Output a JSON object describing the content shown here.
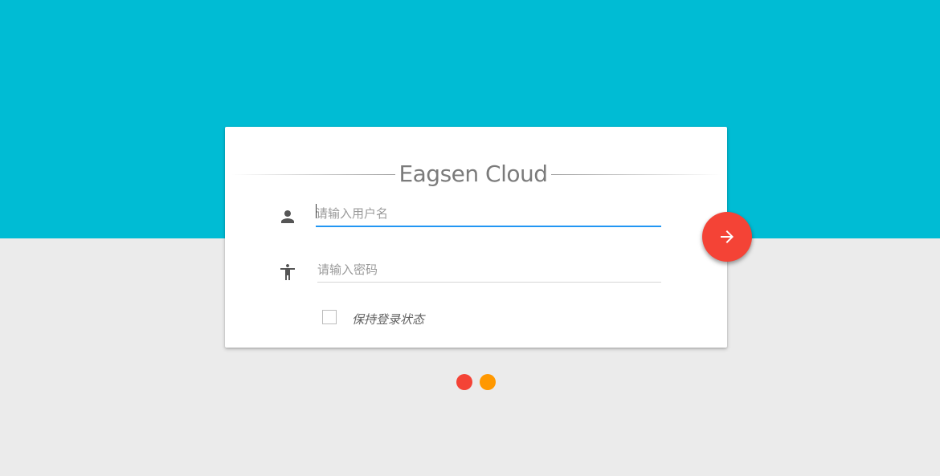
{
  "login": {
    "title": "Eagsen Cloud",
    "username": {
      "value": "",
      "placeholder": "请输入用户名",
      "icon": "person-icon"
    },
    "password": {
      "value": "",
      "placeholder": "请输入密码",
      "icon": "accessibility-icon"
    },
    "remember_label": "保持登录状态",
    "remember_checked": false,
    "submit_icon": "arrow-right-icon"
  },
  "loading": {
    "dots": [
      {
        "color": "#f44336"
      },
      {
        "color": "#ff9800"
      }
    ]
  },
  "colors": {
    "header": "#00bcd4",
    "background": "#ebebeb",
    "accent_input": "#2196f3",
    "submit": "#f44336",
    "icon": "#555555",
    "title": "#7b7b7b"
  }
}
